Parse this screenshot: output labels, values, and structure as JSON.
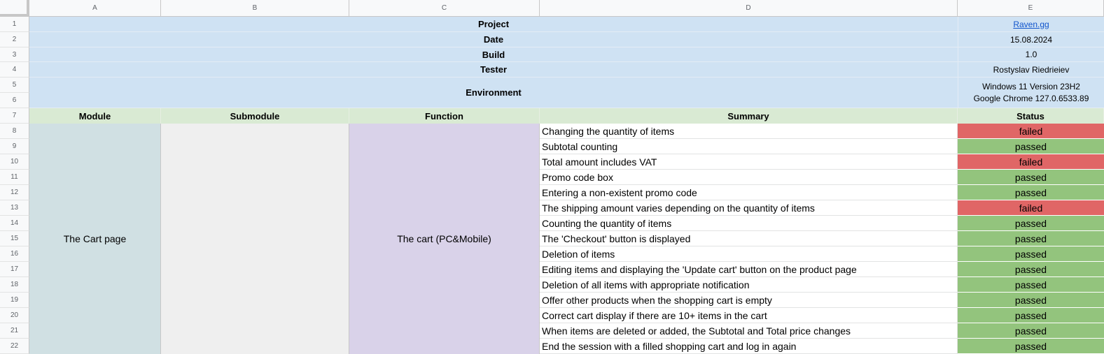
{
  "columns": [
    "A",
    "B",
    "C",
    "D",
    "E"
  ],
  "rows": [
    "1",
    "2",
    "3",
    "4",
    "5",
    "6",
    "7",
    "8",
    "9",
    "10",
    "11",
    "12",
    "13",
    "14",
    "15",
    "16",
    "17",
    "18",
    "19",
    "20",
    "21",
    "22"
  ],
  "meta": {
    "project_label": "Project",
    "project_value": "Raven.gg",
    "date_label": "Date",
    "date_value": "15.08.2024",
    "build_label": "Build",
    "build_value": "1.0",
    "tester_label": "Tester",
    "tester_value": "Rostyslav Riedrieiev",
    "environment_label": "Environment",
    "environment_line1": "Windows 11 Version 23H2",
    "environment_line2": "Google Chrome 127.0.6533.89"
  },
  "table_headers": {
    "module": "Module",
    "submodule": "Submodule",
    "function": "Function",
    "summary": "Summary",
    "status": "Status"
  },
  "module_value": "The Cart page",
  "submodule_value": "",
  "function_value": "The cart (PC&Mobile)",
  "items": [
    {
      "summary": "Changing the quantity of items",
      "status": "failed"
    },
    {
      "summary": "Subtotal counting",
      "status": "passed"
    },
    {
      "summary": "Total amount includes VAT",
      "status": "failed"
    },
    {
      "summary": "Promo code box",
      "status": "passed"
    },
    {
      "summary": "Entering a non-existent promo code",
      "status": "passed"
    },
    {
      "summary": "The shipping amount varies depending on the quantity of items",
      "status": "failed"
    },
    {
      "summary": "Counting the quantity of items",
      "status": "passed"
    },
    {
      "summary": "The 'Checkout' button is displayed",
      "status": "passed"
    },
    {
      "summary": "Deletion of items",
      "status": "passed"
    },
    {
      "summary": "Editing items and displaying the 'Update cart' button on the product page",
      "status": "passed"
    },
    {
      "summary": "Deletion of all items with appropriate notification",
      "status": "passed"
    },
    {
      "summary": "Offer other products when the shopping cart is empty",
      "status": "passed"
    },
    {
      "summary": "Correct cart display if there are 10+ items in the cart",
      "status": "passed"
    },
    {
      "summary": "When items are deleted or added, the Subtotal and Total price changes",
      "status": "passed"
    },
    {
      "summary": "End the session with a filled shopping cart and log in again",
      "status": "passed"
    }
  ],
  "colors": {
    "meta_bg": "#cfe2f3",
    "header_bg": "#d9ead3",
    "module_bg": "#d0e0e3",
    "submodule_bg": "#efefef",
    "function_bg": "#d9d2e9",
    "passed": "#93c47d",
    "failed": "#e06666"
  }
}
